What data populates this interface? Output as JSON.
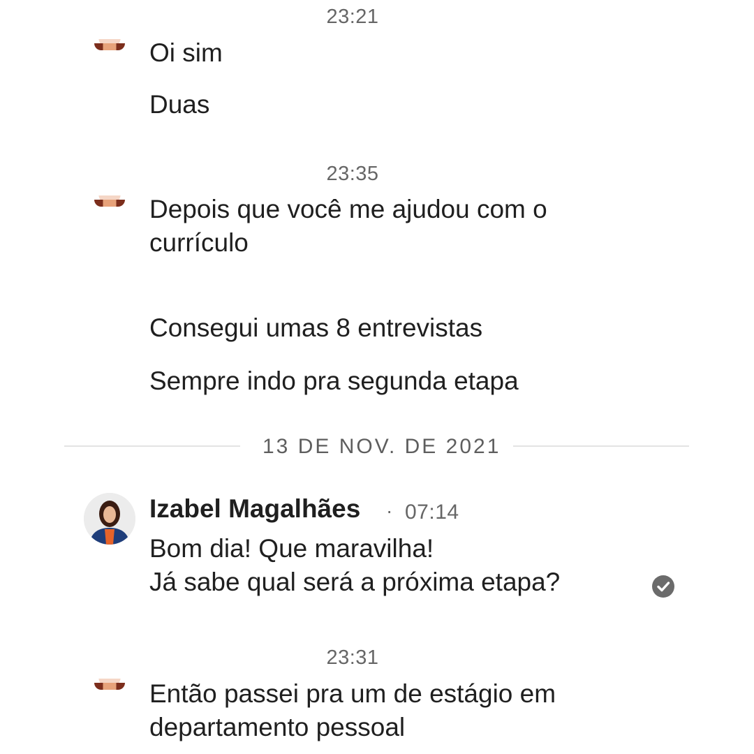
{
  "groups": [
    {
      "time": "23:21",
      "messages": [
        "Oi sim",
        "Duas"
      ]
    },
    {
      "time": "23:35",
      "messages": [
        "Depois que você me ajudou com o",
        "currículo",
        "Consegui umas 8 entrevistas",
        "Sempre indo pra segunda etapa"
      ]
    },
    {
      "time": "23:31",
      "messages": [
        "Então passei pra um de estágio em",
        "departamento pessoal"
      ]
    }
  ],
  "date_separator": "13 DE NOV. DE 2021",
  "reply": {
    "sender": "Izabel Magalhães",
    "separator": "·",
    "time": "07:14",
    "lines": [
      "Bom dia! Que maravilha!",
      "Já sabe qual será a próxima etapa?"
    ],
    "status_icon": "read-check-icon"
  },
  "colors": {
    "text": "#1f1f1f",
    "muted": "#666666",
    "divider": "#e3e3e3",
    "check": "#6b6b6b"
  }
}
